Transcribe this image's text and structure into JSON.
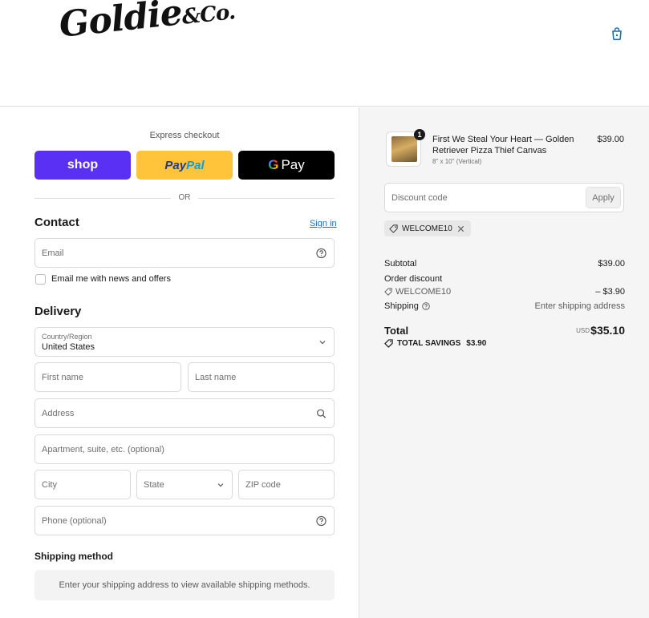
{
  "brand": {
    "name": "Goldie",
    "suffix": "&Co."
  },
  "express": {
    "title": "Express checkout",
    "shop_label": "shop",
    "paypal_label_1": "Pay",
    "paypal_label_2": "Pal",
    "gpay_g": "G",
    "gpay_label": "Pay",
    "or_label": "OR"
  },
  "contact": {
    "title": "Contact",
    "sign_in": "Sign in",
    "email_placeholder": "Email",
    "news_label": "Email me with news and offers"
  },
  "delivery": {
    "title": "Delivery",
    "country_label": "Country/Region",
    "country_value": "United States",
    "first_name": "First name",
    "last_name": "Last name",
    "address": "Address",
    "apartment": "Apartment, suite, etc. (optional)",
    "city": "City",
    "state": "State",
    "zip": "ZIP code",
    "phone": "Phone (optional)"
  },
  "shipping_method": {
    "title": "Shipping method",
    "message": "Enter your shipping address to view available shipping methods."
  },
  "order": {
    "item": {
      "quantity": "1",
      "name": "First We Steal Your Heart — Golden Retriever Pizza Thief Canvas",
      "variant": "8\" x 10\" (Vertical)",
      "price": "$39.00"
    },
    "discount_placeholder": "Discount code",
    "apply_label": "Apply",
    "applied_code": "WELCOME10",
    "subtotal_label": "Subtotal",
    "subtotal_value": "$39.00",
    "order_discount_label": "Order discount",
    "discount_code": "WELCOME10",
    "discount_value": "– $3.90",
    "shipping_label": "Shipping",
    "shipping_value": "Enter shipping address",
    "total_label": "Total",
    "currency": "USD",
    "total_value": "$35.10",
    "savings_label": "TOTAL SAVINGS",
    "savings_value": "$3.90"
  },
  "colors": {
    "shop": "#5a31f4",
    "paypal": "#ffc439",
    "gpay": "#000000",
    "link": "#1a6fb5"
  }
}
